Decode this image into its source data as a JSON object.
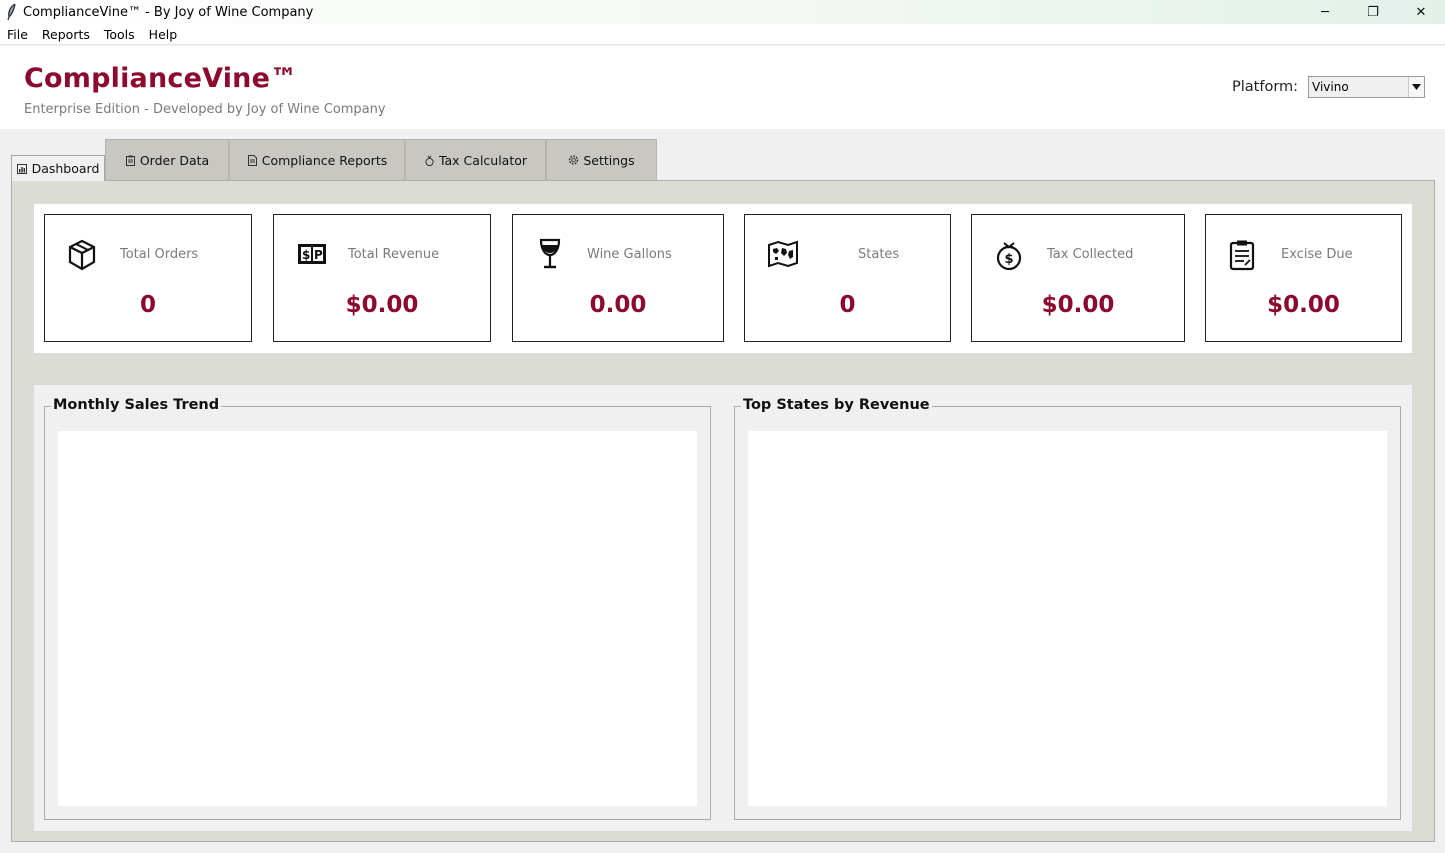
{
  "window": {
    "title": "ComplianceVine™ - By Joy of Wine Company",
    "controls": {
      "minimize": "─",
      "maximize": "❐",
      "close": "✕"
    }
  },
  "menubar": {
    "items": [
      "File",
      "Reports",
      "Tools",
      "Help"
    ]
  },
  "header": {
    "brand": "ComplianceVine™",
    "subtitle": "Enterprise Edition - Developed by Joy of Wine Company",
    "platform_label": "Platform:",
    "platform_value": "Vivino"
  },
  "tabs": [
    {
      "label": "Dashboard",
      "icon": "chart-icon",
      "active": true
    },
    {
      "label": "Order Data",
      "icon": "clipboard-icon",
      "active": false
    },
    {
      "label": "Compliance Reports",
      "icon": "document-icon",
      "active": false
    },
    {
      "label": "Tax Calculator",
      "icon": "money-bag-icon",
      "active": false
    },
    {
      "label": "Settings",
      "icon": "gear-icon",
      "active": false
    }
  ],
  "cards": [
    {
      "label": "Total Orders",
      "value": "0",
      "icon": "package-icon"
    },
    {
      "label": "Total Revenue",
      "value": "$0.00",
      "icon": "dollar-bill-icon"
    },
    {
      "label": "Wine Gallons",
      "value": "0.00",
      "icon": "wine-glass-icon"
    },
    {
      "label": "States",
      "value": "0",
      "icon": "map-icon"
    },
    {
      "label": "Tax Collected",
      "value": "$0.00",
      "icon": "money-bag-icon"
    },
    {
      "label": "Excise Due",
      "value": "$0.00",
      "icon": "clipboard-icon"
    }
  ],
  "charts": {
    "monthly": {
      "title": "Monthly Sales Trend"
    },
    "states": {
      "title": "Top States by Revenue"
    }
  }
}
